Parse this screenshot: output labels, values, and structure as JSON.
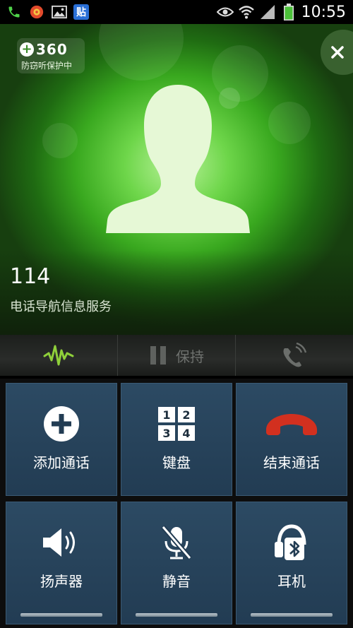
{
  "status_bar": {
    "badge_label": "贴",
    "time": "10:55"
  },
  "caller": {
    "badge": {
      "brand": "360",
      "subtitle": "防窃听保护中"
    },
    "number": "114",
    "name": "电话导航信息服务"
  },
  "control_strip": {
    "hold_label": "保持"
  },
  "buttons": {
    "add_call": "添加通话",
    "keypad": "键盘",
    "keypad_digits": [
      "1",
      "2",
      "3",
      "4"
    ],
    "end_call": "结束通话",
    "speaker": "扬声器",
    "mute": "静音",
    "headset": "耳机"
  },
  "colors": {
    "end_call_red": "#d2301f",
    "button_bg": "#264560",
    "accent_green": "#5fcf3a"
  }
}
